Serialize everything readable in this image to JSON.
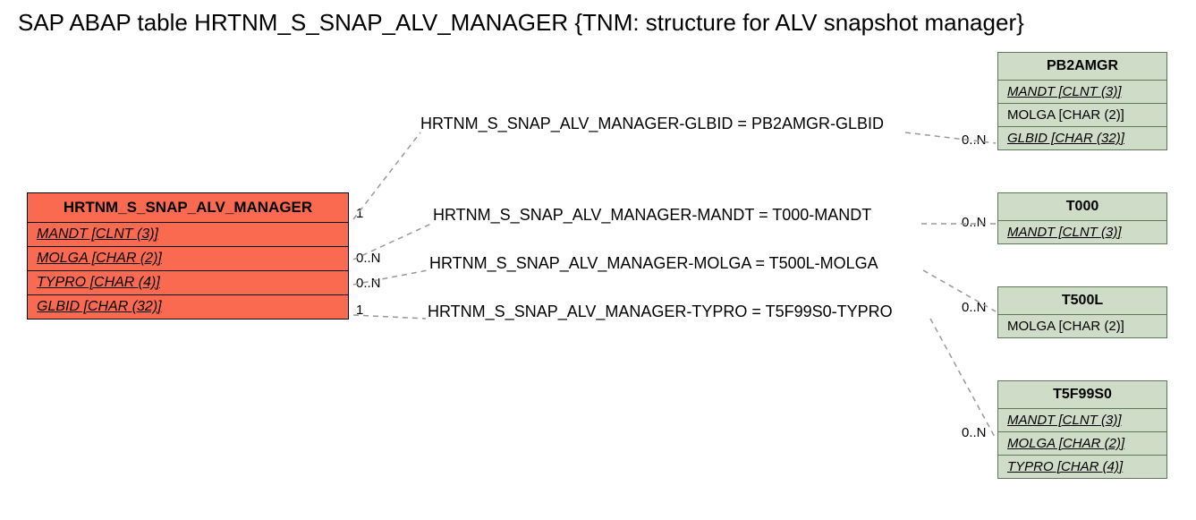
{
  "title": "SAP ABAP table HRTNM_S_SNAP_ALV_MANAGER {TNM: structure for ALV snapshot manager}",
  "main": {
    "name": "HRTNM_S_SNAP_ALV_MANAGER",
    "fields": [
      "MANDT [CLNT (3)]",
      "MOLGA [CHAR (2)]",
      "TYPRO [CHAR (4)]",
      "GLBID [CHAR (32)]"
    ]
  },
  "refs": {
    "pb2amgr": {
      "name": "PB2AMGR",
      "fields": [
        "MANDT [CLNT (3)]",
        "MOLGA [CHAR (2)]",
        "GLBID [CHAR (32)]"
      ]
    },
    "t000": {
      "name": "T000",
      "fields": [
        "MANDT [CLNT (3)]"
      ]
    },
    "t500l": {
      "name": "T500L",
      "fields": [
        "MOLGA [CHAR (2)]"
      ]
    },
    "t5f99s0": {
      "name": "T5F99S0",
      "fields": [
        "MANDT [CLNT (3)]",
        "MOLGA [CHAR (2)]",
        "TYPRO [CHAR (4)]"
      ]
    }
  },
  "rels": {
    "r1": "HRTNM_S_SNAP_ALV_MANAGER-GLBID = PB2AMGR-GLBID",
    "r2": "HRTNM_S_SNAP_ALV_MANAGER-MANDT = T000-MANDT",
    "r3": "HRTNM_S_SNAP_ALV_MANAGER-MOLGA = T500L-MOLGA",
    "r4": "HRTNM_S_SNAP_ALV_MANAGER-TYPRO = T5F99S0-TYPRO"
  },
  "cards": {
    "c1l": "1",
    "c1r": "0..N",
    "c2l": "0..N",
    "c2r": "0..N",
    "c3l": "0..N",
    "c3r": "0..N",
    "c4l": "1",
    "c4r": "0..N"
  }
}
